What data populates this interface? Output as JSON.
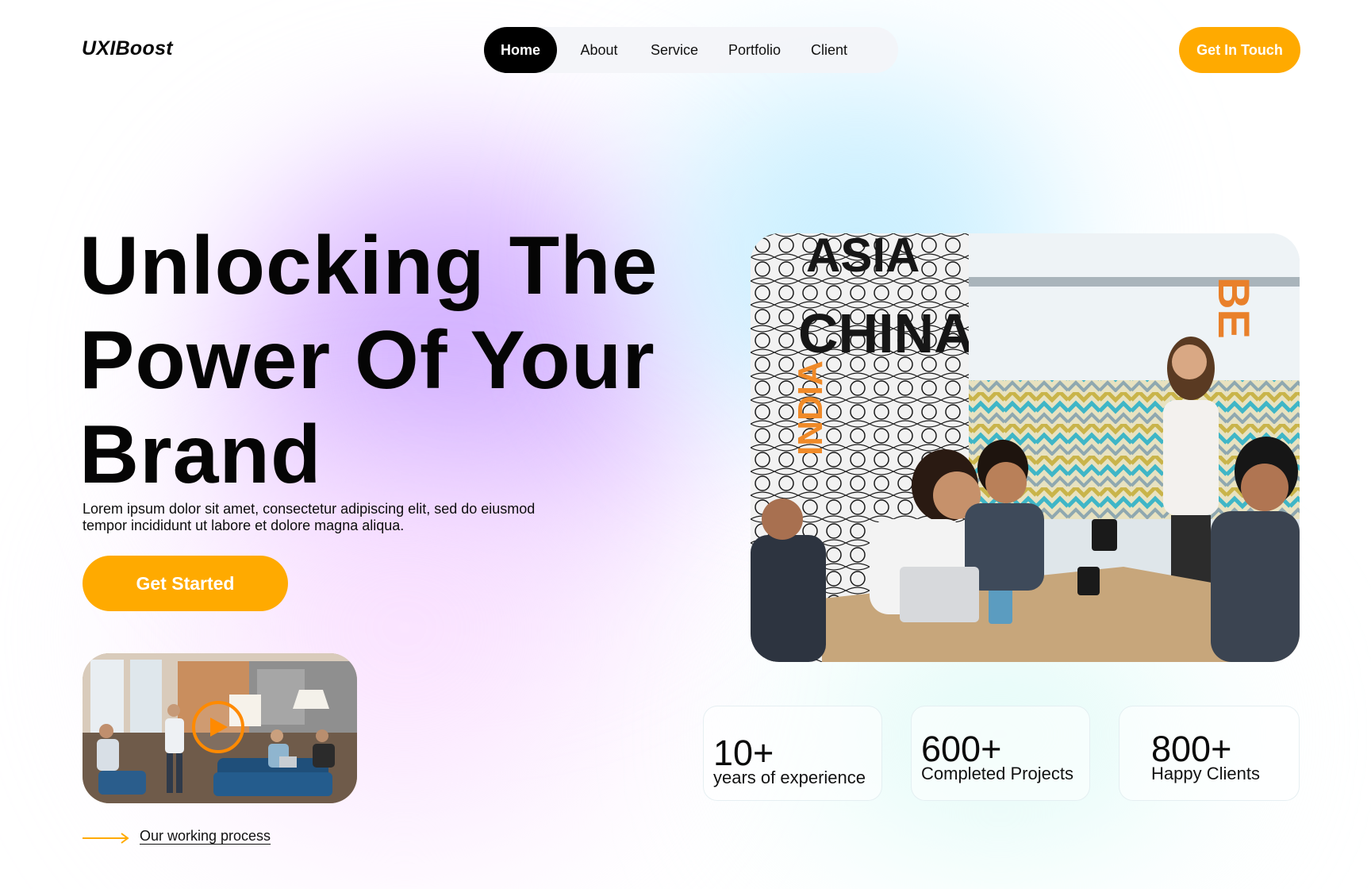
{
  "brand": {
    "name": "UXIBoost"
  },
  "nav": {
    "items": [
      {
        "label": "Home",
        "active": true
      },
      {
        "label": "About"
      },
      {
        "label": "Service"
      },
      {
        "label": "Portfolio"
      },
      {
        "label": "Client"
      }
    ],
    "cta_label": "Get In Touch"
  },
  "hero": {
    "headline_lines": [
      "Unlocking The",
      "Power Of Your",
      "Brand"
    ],
    "subtitle": "Lorem ipsum dolor sit amet, consectetur adipiscing elit, sed do eiusmod tempor incididunt ut labore et dolore magna aliqua.",
    "cta_label": "Get Started",
    "video": {
      "icon": "play-icon"
    },
    "process_link": {
      "label": "Our working process",
      "icon": "arrow-right-icon"
    },
    "photo_wall_text": {
      "top": "ASIA",
      "middle": "CHINA",
      "side": "INDIA",
      "sign": "BE"
    }
  },
  "stats": [
    {
      "value": "10+",
      "label": "years of experience"
    },
    {
      "value": "600+",
      "label": "Completed Projects"
    },
    {
      "value": "800+",
      "label": "Happy Clients"
    }
  ],
  "colors": {
    "accent": "#ffaa00",
    "nav_active_bg": "#000000",
    "nav_bg": "#f3f4f8",
    "play_ring": "#ff8a00"
  }
}
